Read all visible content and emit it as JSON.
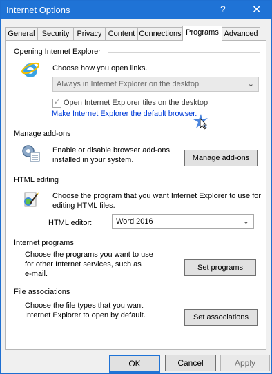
{
  "window": {
    "title": "Internet Options",
    "help": "?",
    "close": "✕"
  },
  "tabs": [
    {
      "label": "General"
    },
    {
      "label": "Security"
    },
    {
      "label": "Privacy"
    },
    {
      "label": "Content"
    },
    {
      "label": "Connections"
    },
    {
      "label": "Programs"
    },
    {
      "label": "Advanced"
    }
  ],
  "opening_ie": {
    "title": "Opening Internet Explorer",
    "description": "Choose how you open links.",
    "dropdown_value": "Always in Internet Explorer on the desktop",
    "checkbox_label": "Open Internet Explorer tiles on the desktop",
    "default_link": "Make Internet Explorer the default browser."
  },
  "addons": {
    "title": "Manage add-ons",
    "line1": "Enable or disable browser add-ons",
    "line2": "installed in your system.",
    "button": "Manage add-ons"
  },
  "html_editing": {
    "title": "HTML editing",
    "line1": "Choose the program that you want Internet Explorer to use for",
    "line2": "editing HTML files.",
    "editor_label": "HTML editor:",
    "editor_value": "Word 2016"
  },
  "internet_programs": {
    "title": "Internet programs",
    "line1": "Choose the programs you want to use",
    "line2": "for other Internet services, such as",
    "line3": "e-mail.",
    "button": "Set programs"
  },
  "file_assoc": {
    "title": "File associations",
    "line1": "Choose the file types that you want",
    "line2": "Internet Explorer to open by default.",
    "button": "Set associations"
  },
  "footer": {
    "ok": "OK",
    "cancel": "Cancel",
    "apply": "Apply"
  },
  "colors": {
    "titlebar": "#1f73d6",
    "link": "#003bd8"
  },
  "icons": [
    "ie-logo-icon",
    "addons-gear-icon",
    "html-editor-icon",
    "cursor-arrow-icon",
    "chevron-down-icon",
    "checkmark-icon"
  ]
}
